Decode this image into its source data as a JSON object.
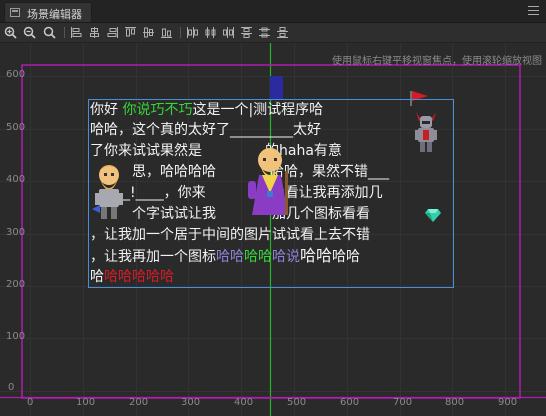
{
  "window": {
    "tab_label": "场景编辑器",
    "tab_icon": "scene-icon",
    "menu_icon": "menu-icon"
  },
  "toolbar": {
    "icons": [
      "zoom-in-icon",
      "zoom-out-icon",
      "zoom-reset-icon",
      "align-left-icon",
      "align-center-h-icon",
      "align-right-icon",
      "align-top-icon",
      "align-middle-v-icon",
      "align-bottom-icon",
      "distribute-left-icon",
      "distribute-center-h-icon",
      "distribute-right-icon",
      "distribute-top-icon",
      "distribute-middle-v-icon",
      "distribute-bottom-icon"
    ]
  },
  "viewport": {
    "hint": "使用鼠标右键平移视窗焦点，使用滚轮缩放视图",
    "x_ticks": [
      "0",
      "100",
      "200",
      "300",
      "400",
      "500",
      "600",
      "700",
      "800",
      "900"
    ],
    "y_ticks": [
      "600",
      "500",
      "400",
      "300",
      "200",
      "100",
      "0"
    ],
    "colors": {
      "design_frame": "#b01cb0",
      "selection": "#4a8ed8",
      "y_axis": "#23b523",
      "x_axis": "#b01cb0"
    }
  },
  "richtext": {
    "line1": {
      "a": "你好",
      "b": "你说",
      "c": "巧不巧",
      "d": "这是一个|测试程序哈"
    },
    "line2": "哈哈，这个真的太好了_________太好",
    "line3": {
      "a": "了你来试试果然是",
      "b": "的haha有意"
    },
    "line4": {
      "a": "思，哈哈哈哈",
      "b": "哈哈，果然不错___"
    },
    "line5": {
      "a": "__!____，你来",
      "b": "看看让我再添加几"
    },
    "line6": {
      "a": "个字试试让我",
      "b": "加几个图标看看"
    },
    "line7": "，让我加一个居于中间的图片试试看上去不错",
    "line8": {
      "a": "，让我再加一个图标",
      "b": "哈哈",
      "c": "哈哈",
      "d": "哈说",
      "e": "哈哈",
      "f": "哈哈"
    },
    "line9": {
      "a": "哈",
      "b": "哈哈哈哈哈"
    },
    "colors": {
      "text": "#f2f2f2",
      "green": "#37d637",
      "purple": "#8b84d8",
      "red": "#d81b24"
    }
  }
}
